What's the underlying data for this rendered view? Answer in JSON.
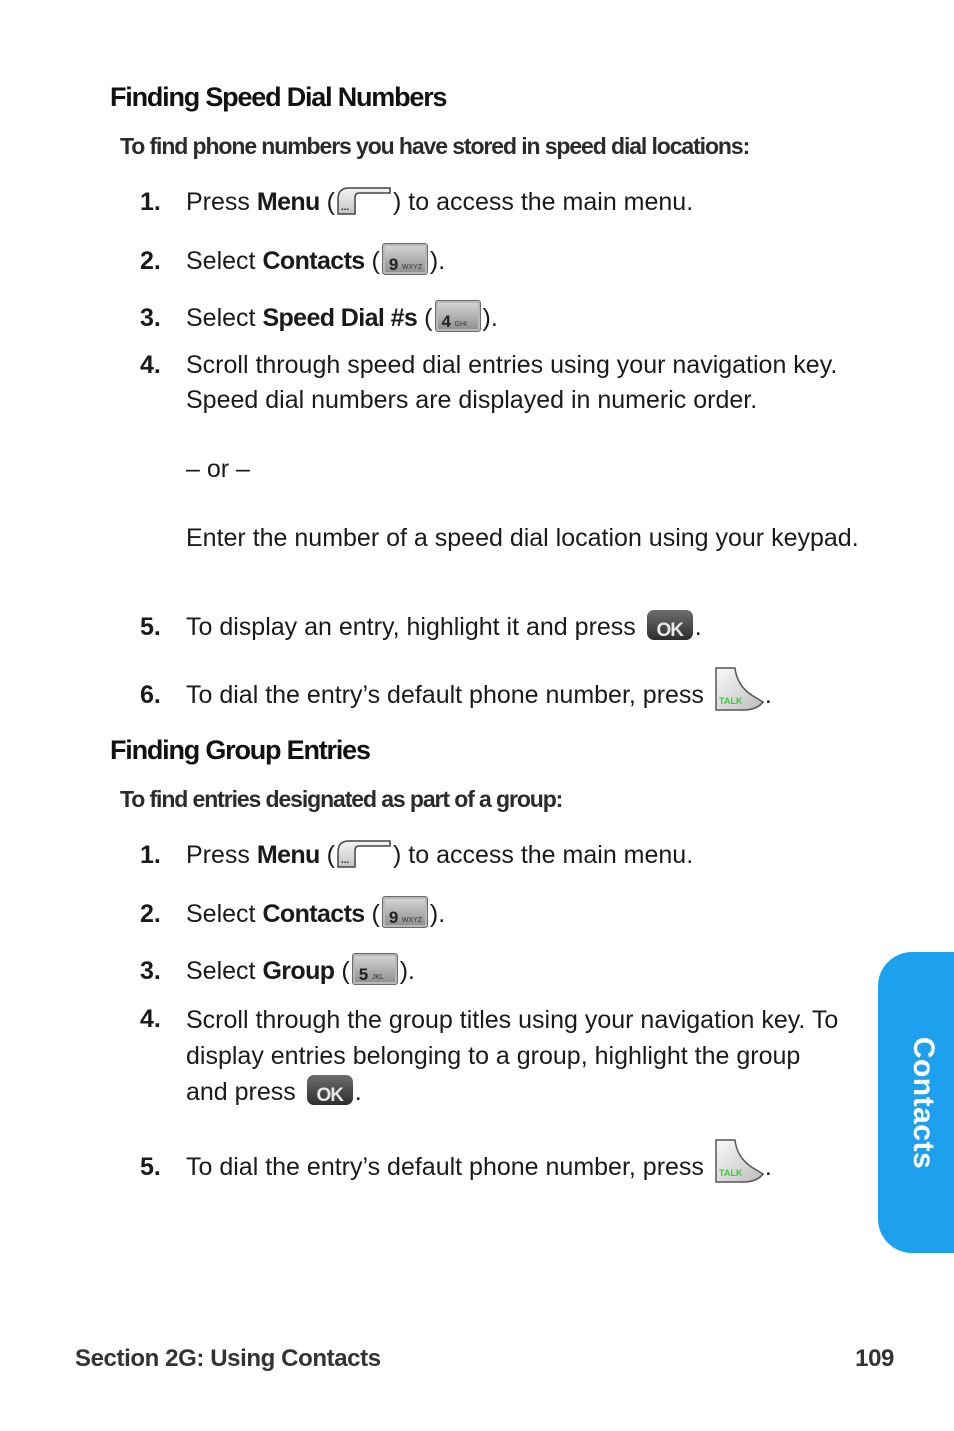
{
  "section1": {
    "heading": "Finding Speed Dial Numbers",
    "intro": "To find phone numbers you have stored in speed dial locations:",
    "steps": [
      {
        "num": "1.",
        "pre": "Press ",
        "bold": "Menu",
        "open": " (",
        "close": ") to access the main menu.",
        "icon": "menu-key-icon"
      },
      {
        "num": "2.",
        "pre": "Select ",
        "bold": "Contacts",
        "open": " (",
        "close": ").",
        "icon": "key-9-wxyz-icon",
        "key_digit": "9",
        "key_letters": "WXYZ"
      },
      {
        "num": "3.",
        "pre": "Select ",
        "bold": "Speed Dial #s",
        "open": " (",
        "close": ").",
        "icon": "key-4-ghi-icon",
        "key_digit": "4",
        "key_letters": "GHI"
      },
      {
        "num": "4.",
        "text": "Scroll through speed dial entries using your navigation key. Speed dial numbers are displayed in numeric order.",
        "or": "– or –",
        "text2": "Enter the number of a speed dial location using your keypad."
      },
      {
        "num": "5.",
        "text": "To display an entry, highlight it and press ",
        "end": ".",
        "icon": "ok-key-icon",
        "key_label": "OK"
      },
      {
        "num": "6.",
        "text": "To dial the entry’s default phone number, press ",
        "end": ".",
        "icon": "talk-key-icon",
        "key_label": "TALK"
      }
    ]
  },
  "section2": {
    "heading": "Finding Group Entries",
    "intro": "To find entries designated as part of a group:",
    "steps": [
      {
        "num": "1.",
        "pre": "Press ",
        "bold": "Menu",
        "open": " (",
        "close": ") to access the main menu.",
        "icon": "menu-key-icon"
      },
      {
        "num": "2.",
        "pre": "Select ",
        "bold": "Contacts",
        "open": " (",
        "close": ").",
        "icon": "key-9-wxyz-icon",
        "key_digit": "9",
        "key_letters": "WXYZ"
      },
      {
        "num": "3.",
        "pre": "Select ",
        "bold": "Group",
        "open": " (",
        "close": ").",
        "icon": "key-5-jkl-icon",
        "key_digit": "5",
        "key_letters": "JKL"
      },
      {
        "num": "4.",
        "text": "Scroll through the group titles using your navigation key. To display entries belonging to a group, highlight the group and press ",
        "end": ".",
        "icon": "ok-key-icon",
        "key_label": "OK"
      },
      {
        "num": "5.",
        "text": "To dial the entry’s default phone number, press ",
        "end": ".",
        "icon": "talk-key-icon",
        "key_label": "TALK"
      }
    ]
  },
  "side_tab": {
    "label": "Contacts",
    "color": "#1da1ee"
  },
  "footer": {
    "section": "Section 2G: Using Contacts",
    "page": "109"
  }
}
